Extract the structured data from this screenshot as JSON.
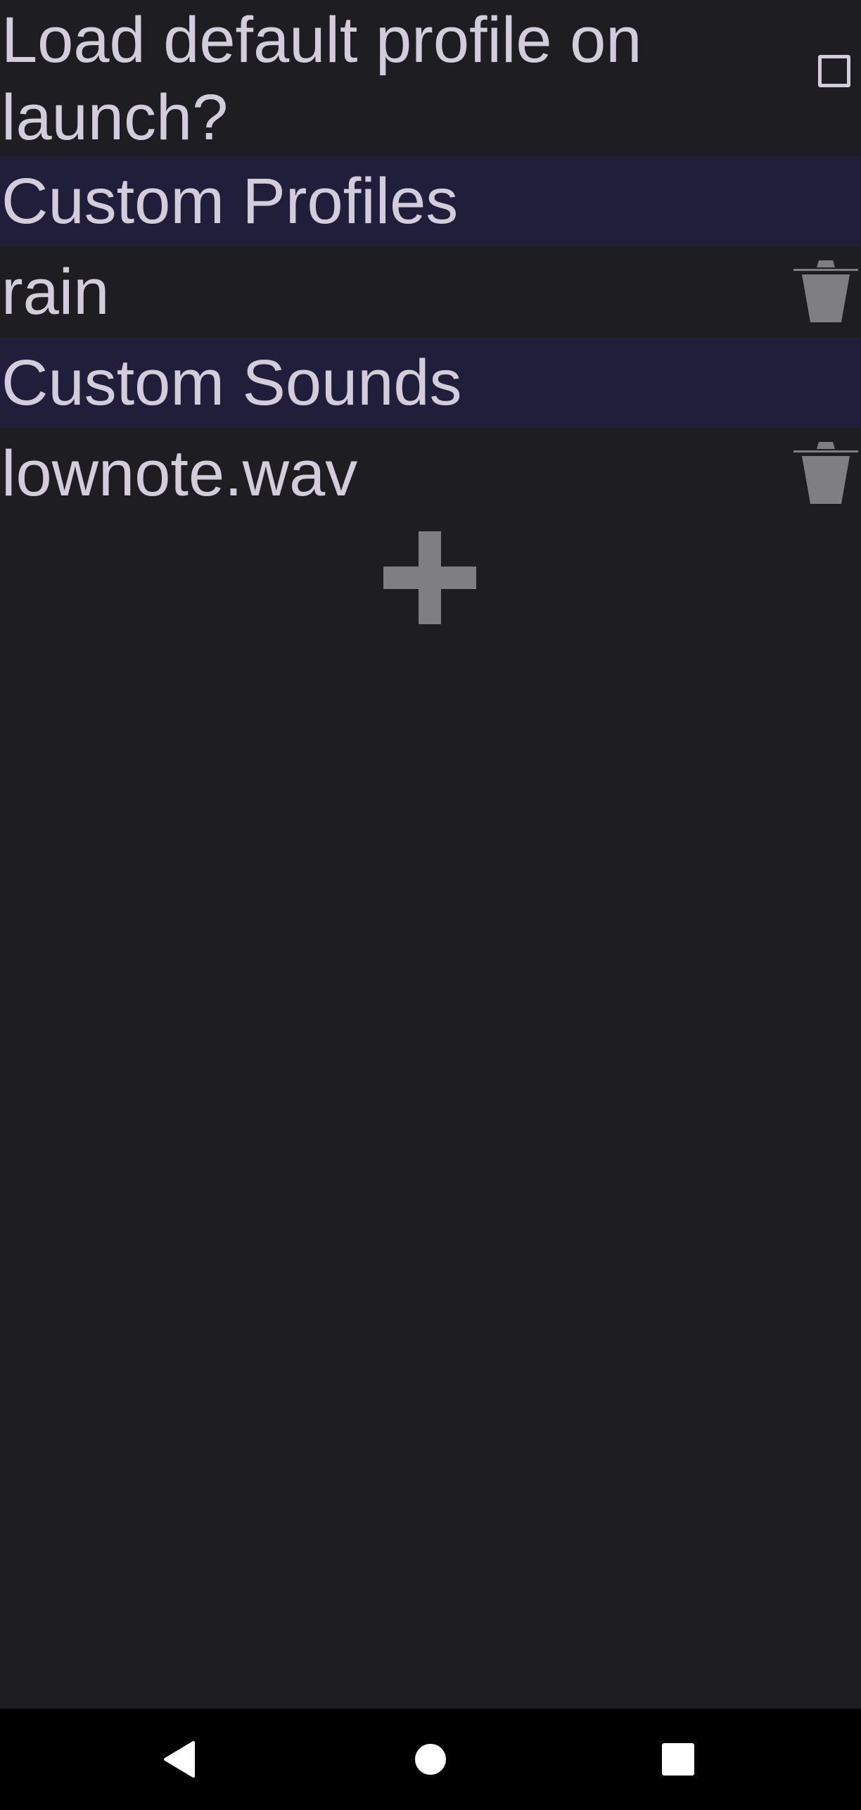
{
  "settings": {
    "load_default_label": "Load default profile on launch?",
    "load_default_checked": false
  },
  "profiles": {
    "header": "Custom Profiles",
    "items": [
      {
        "name": "rain"
      }
    ]
  },
  "sounds": {
    "header": "Custom Sounds",
    "items": [
      {
        "name": "lownote.wav"
      }
    ]
  },
  "icons": {
    "delete": "trash-icon",
    "add": "plus-icon",
    "nav_back": "triangle-back-icon",
    "nav_home": "circle-home-icon",
    "nav_recents": "square-recents-icon"
  },
  "colors": {
    "background": "#1e1d22",
    "section_header": "#201e3a",
    "text": "#d3ccdb",
    "icon_gray": "#7f7e83",
    "nav_bar": "#000000",
    "nav_icon": "#ffffff"
  }
}
